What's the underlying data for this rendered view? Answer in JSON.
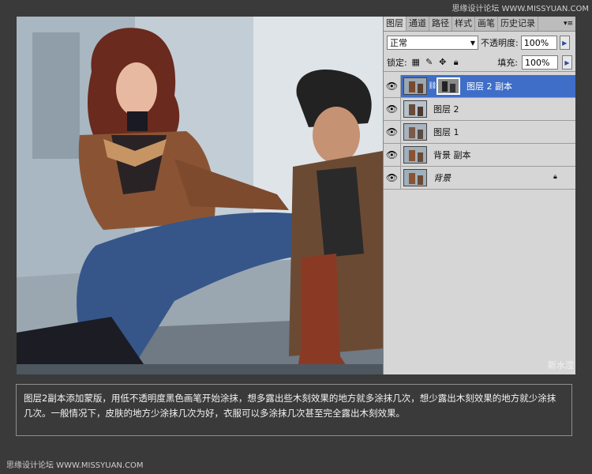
{
  "watermark_top": "思缘设计论坛 WWW.MISSYUAN.COM",
  "watermark_bottom": "思缘设计论坛 WWW.MISSYUAN.COM",
  "photo_watermark": "靳水滢",
  "panel": {
    "tabs": [
      {
        "label": "图层",
        "active": true
      },
      {
        "label": "通道",
        "active": false
      },
      {
        "label": "路径",
        "active": false
      },
      {
        "label": "样式",
        "active": false
      },
      {
        "label": "画笔",
        "active": false
      },
      {
        "label": "历史记录",
        "active": false
      }
    ],
    "menu_icon": "▾≡",
    "blend_mode": "正常",
    "opacity_label": "不透明度:",
    "opacity_value": "100%",
    "lock_label": "锁定:",
    "fill_label": "填充:",
    "fill_value": "100%",
    "arrow_glyph": "▶",
    "layers": [
      {
        "name": "图层 2 副本",
        "selected": true,
        "has_mask": true
      },
      {
        "name": "图层 2",
        "selected": false
      },
      {
        "name": "图层 1",
        "selected": false
      },
      {
        "name": "背景 副本",
        "selected": false
      },
      {
        "name": "背景",
        "selected": false,
        "italic": true,
        "locked": true
      }
    ]
  },
  "caption": "图层2副本添加蒙版，用低不透明度黑色画笔开始涂抹，想多露出些木刻效果的地方就多涂抹几次，想少露出木刻效果的地方就少涂抹几次。一般情况下，皮肤的地方少涂抹几次为好，衣服可以多涂抹几次甚至完全露出木刻效果。"
}
